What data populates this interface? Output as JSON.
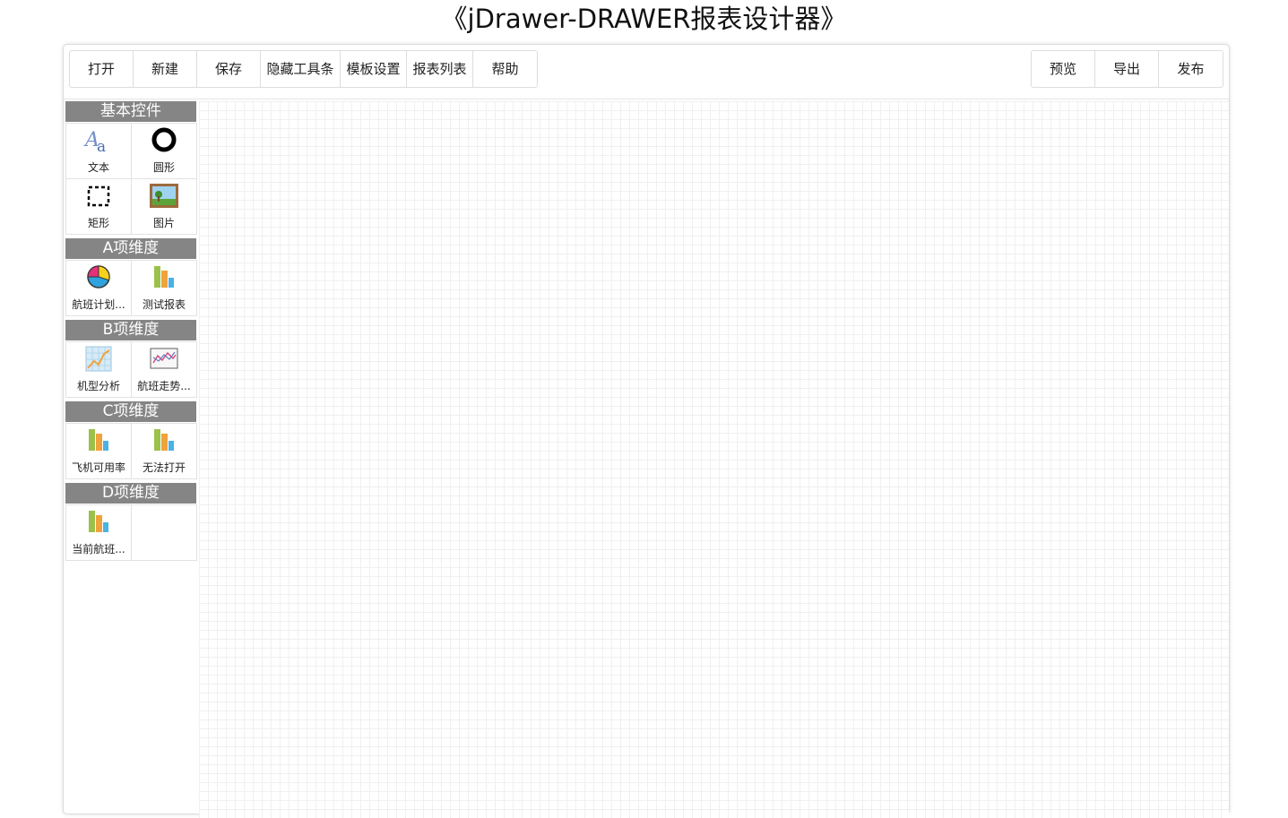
{
  "title": "《jDrawer-DRAWER报表设计器》",
  "toolbar": {
    "left": [
      "打开",
      "新建",
      "保存",
      "隐藏工具条",
      "模板设置",
      "报表列表",
      "帮助"
    ],
    "right": [
      "预览",
      "导出",
      "发布"
    ]
  },
  "sidebar": {
    "groups": [
      {
        "title": "基本控件",
        "items": [
          {
            "label": "文本",
            "icon": "text-icon"
          },
          {
            "label": "圆形",
            "icon": "circle-icon"
          },
          {
            "label": "矩形",
            "icon": "rectangle-icon"
          },
          {
            "label": "图片",
            "icon": "picture-icon"
          }
        ]
      },
      {
        "title": "A项维度",
        "items": [
          {
            "label": "航班计划...",
            "icon": "pie-chart-icon"
          },
          {
            "label": "测试报表",
            "icon": "bar-chart-icon"
          }
        ]
      },
      {
        "title": "B项维度",
        "items": [
          {
            "label": "机型分析",
            "icon": "line-chart-icon"
          },
          {
            "label": "航班走势...",
            "icon": "trend-chart-icon"
          }
        ]
      },
      {
        "title": "C项维度",
        "items": [
          {
            "label": "飞机可用率",
            "icon": "bar-chart-icon"
          },
          {
            "label": "无法打开",
            "icon": "bar-chart-icon"
          }
        ]
      },
      {
        "title": "D项维度",
        "items": [
          {
            "label": "当前航班...",
            "icon": "bar-chart-icon"
          }
        ]
      }
    ]
  }
}
